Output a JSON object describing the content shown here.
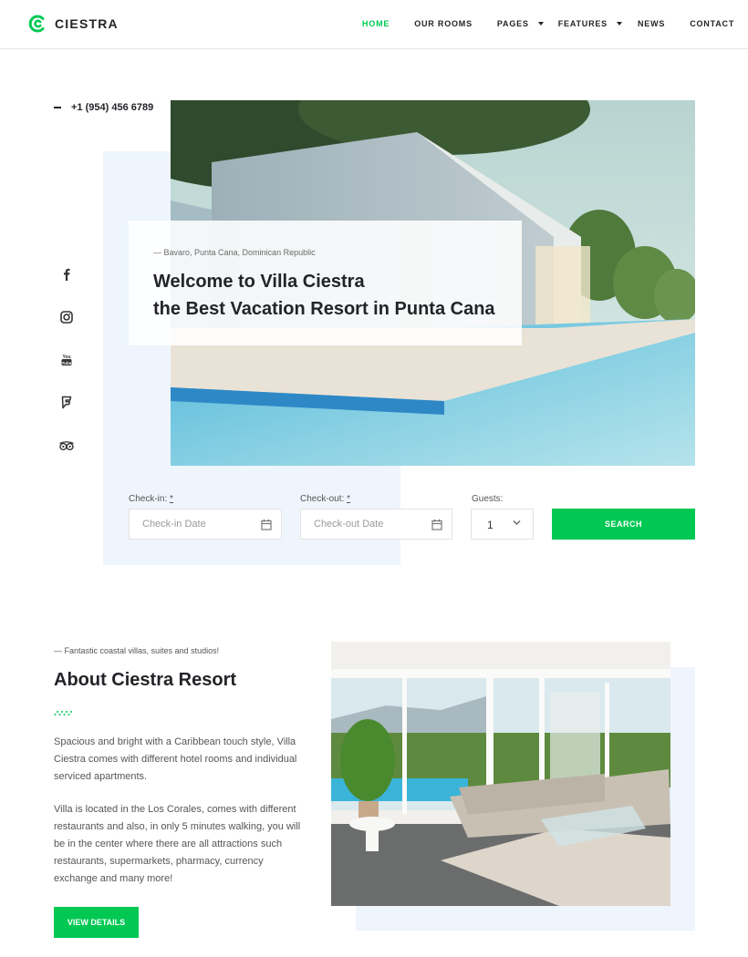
{
  "brand": {
    "name": "CIESTRA",
    "accent_color": "#00c853",
    "panel_color": "#eef5fc"
  },
  "nav": {
    "items": [
      {
        "label": "HOME",
        "active": true,
        "has_dropdown": false
      },
      {
        "label": "OUR ROOMS",
        "active": false,
        "has_dropdown": false
      },
      {
        "label": "PAGES",
        "active": false,
        "has_dropdown": true
      },
      {
        "label": "FEATURES",
        "active": false,
        "has_dropdown": true
      },
      {
        "label": "NEWS",
        "active": false,
        "has_dropdown": false
      },
      {
        "label": "CONTACT",
        "active": false,
        "has_dropdown": false
      }
    ]
  },
  "hero": {
    "phone": "+1 (954) 456 6789",
    "location": "— Bavaro, Punta Cana, Dominican Republic",
    "title_line1": "Welcome to Villa Ciestra",
    "title_line2": "the Best Vacation Resort in Punta Cana",
    "image_alt": "Modern villa with infinity pool"
  },
  "social": [
    {
      "name": "facebook-icon"
    },
    {
      "name": "instagram-icon"
    },
    {
      "name": "youtube-icon"
    },
    {
      "name": "foursquare-icon"
    },
    {
      "name": "tripadvisor-icon"
    }
  ],
  "booking": {
    "checkin_label": "Check-in:",
    "checkout_label": "Check-out:",
    "required_mark": "*",
    "checkin_placeholder": "Check-in Date",
    "checkout_placeholder": "Check-out Date",
    "guests_label": "Guests:",
    "guests_value": "1",
    "search_label": "SEARCH"
  },
  "about": {
    "subtitle": "— Fantastic coastal villas, suites and studios!",
    "title": "About Ciestra Resort",
    "paragraph1": "Spacious and bright with a Caribbean touch style, Villa Ciestra comes with different hotel rooms and individual serviced apartments.",
    "paragraph2": "Villa is located in the Los Corales, comes with different restaurants and also, in only 5 minutes walking, you will be in the center where there are all attractions such restaurants, supermarkets, pharmacy, currency exchange and many more!",
    "button_label": "VIEW DETAILS",
    "image_alt": "Bright living room with sofa and pool view"
  }
}
